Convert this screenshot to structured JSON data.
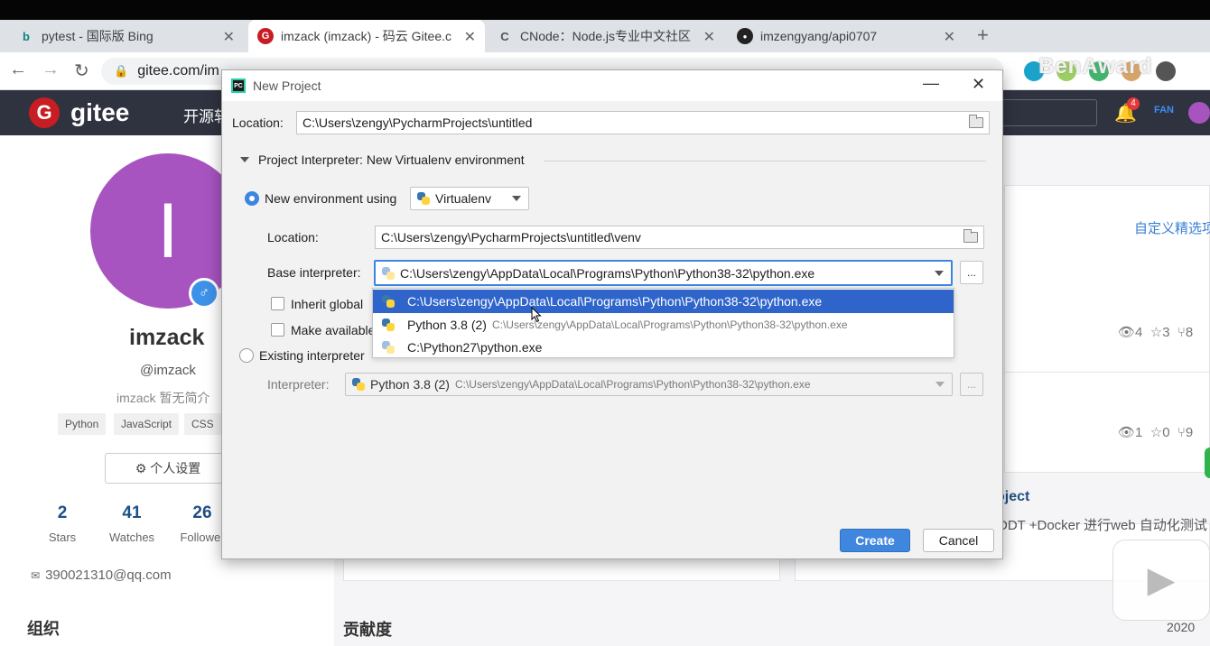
{
  "browser": {
    "tabs": [
      {
        "title": "pytest - 国际版 Bing",
        "favicon": "b"
      },
      {
        "title": "imzack (imzack) - 码云 Gitee.c",
        "favicon": "G"
      },
      {
        "title": "CNode：Node.js专业中文社区",
        "favicon": "C"
      },
      {
        "title": "imzengyang/api0707",
        "favicon": "gh"
      }
    ],
    "url": "gitee.com/im",
    "watermark": "BenAward"
  },
  "gitee": {
    "logo_text": "gitee",
    "nav_link": "开源软",
    "notification_count": "4",
    "user_short": "FAN"
  },
  "profile": {
    "avatar_letter": "I",
    "gender_symbol": "♂",
    "name": "imzack",
    "handle": "@imzack",
    "bio": "imzack 暂无简介",
    "tags": [
      "Python",
      "JavaScript",
      "CSS"
    ],
    "settings_button": "个人设置",
    "stats": [
      {
        "num": "2",
        "label": "Stars"
      },
      {
        "num": "41",
        "label": "Watches"
      },
      {
        "num": "26",
        "label": "Follower"
      }
    ],
    "email": "390021310@qq.com",
    "org_title": "组织",
    "contrib_title": "贡献度",
    "year": "2020"
  },
  "right_content": {
    "custom_link": "自定义精选项",
    "card1_meta": {
      "views": "4",
      "stars": "3",
      "forks": "8"
    },
    "card2_meta": {
      "views": "1",
      "stars": "0",
      "forks": "9"
    },
    "project_title": "oject",
    "project_desc": "DDT +Docker 进行web 自动化测试"
  },
  "dialog": {
    "title": "New Project",
    "location_label": "Location:",
    "location_value": "C:\\Users\\zengy\\PycharmProjects\\untitled",
    "section_title": "Project Interpreter: New Virtualenv environment",
    "new_env_label": "New environment using",
    "env_tool": "Virtualenv",
    "venv_location_label": "Location:",
    "venv_location_value": "C:\\Users\\zengy\\PycharmProjects\\untitled\\venv",
    "base_interp_label": "Base interpreter:",
    "base_interp_value": "C:\\Users\\zengy\\AppData\\Local\\Programs\\Python\\Python38-32\\python.exe",
    "inherit_label": "Inherit global",
    "make_available_label": "Make available",
    "existing_label": "Existing interpreter",
    "interpreter_label": "Interpreter:",
    "interpreter_name": "Python 3.8 (2)",
    "interpreter_path": "C:\\Users\\zengy\\AppData\\Local\\Programs\\Python\\Python38-32\\python.exe",
    "dropdown_items": [
      {
        "main": "C:\\Users\\zengy\\AppData\\Local\\Programs\\Python\\Python38-32\\python.exe",
        "sub": ""
      },
      {
        "main": "Python 3.8 (2)",
        "sub": "C:\\Users\\zengy\\AppData\\Local\\Programs\\Python\\Python38-32\\python.exe"
      },
      {
        "main": "C:\\Python27\\python.exe",
        "sub": ""
      }
    ],
    "dots_label": "...",
    "create_button": "Create",
    "cancel_button": "Cancel"
  }
}
